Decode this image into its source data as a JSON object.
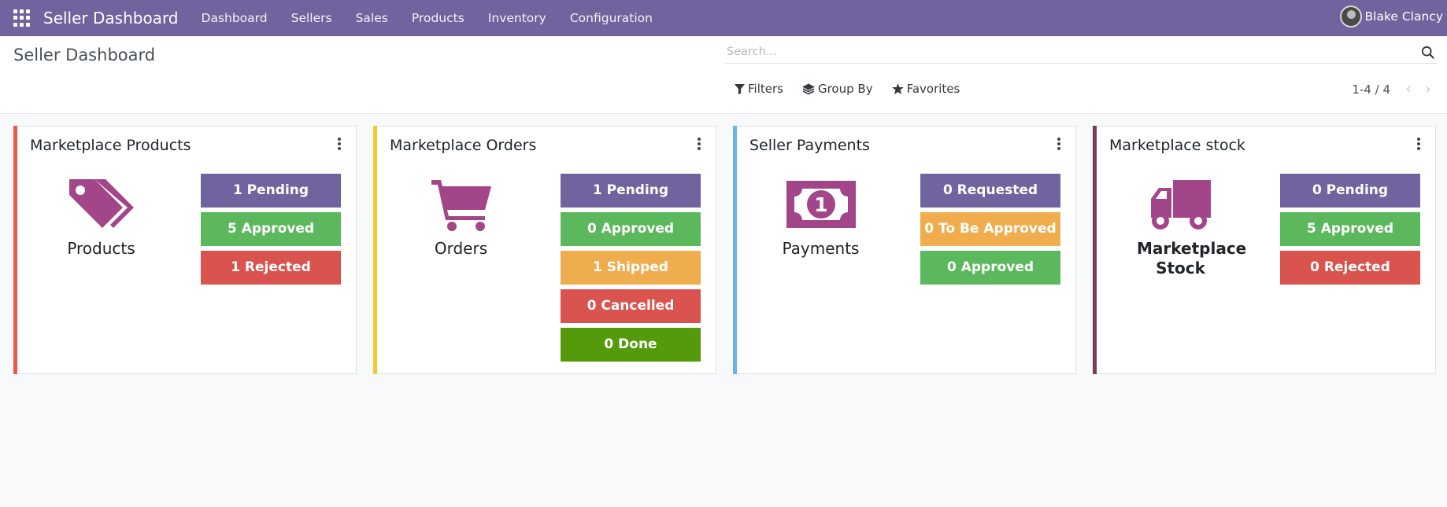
{
  "navbar": {
    "app_title": "Seller Dashboard",
    "menu": [
      "Dashboard",
      "Sellers",
      "Sales",
      "Products",
      "Inventory",
      "Configuration"
    ],
    "user_name": "Blake Clancy"
  },
  "control": {
    "title": "Seller Dashboard",
    "search_placeholder": "Search...",
    "filters_label": "Filters",
    "groupby_label": "Group By",
    "favorites_label": "Favorites",
    "pager": "1-4 / 4"
  },
  "colors": {
    "purple": "#71639e",
    "green": "#5cb85c",
    "red": "#d9534f",
    "orange": "#f0ad4e",
    "dark_green": "#559a0b",
    "icon": "#a24689"
  },
  "cards": [
    {
      "title": "Marketplace Products",
      "stripe": "#e8584c",
      "icon": "tags-icon",
      "label": "Products",
      "stats": [
        {
          "text": "1 Pending",
          "color": "#71639e"
        },
        {
          "text": "5 Approved",
          "color": "#5cb85c"
        },
        {
          "text": "1 Rejected",
          "color": "#d9534f"
        }
      ]
    },
    {
      "title": "Marketplace Orders",
      "stripe": "#f4c92f",
      "icon": "cart-icon",
      "label": "Orders",
      "stats": [
        {
          "text": "1 Pending",
          "color": "#71639e"
        },
        {
          "text": "0 Approved",
          "color": "#5cb85c"
        },
        {
          "text": "1 Shipped",
          "color": "#f0ad4e"
        },
        {
          "text": "0 Cancelled",
          "color": "#d9534f"
        },
        {
          "text": "0 Done",
          "color": "#559a0b"
        }
      ]
    },
    {
      "title": "Seller Payments",
      "stripe": "#6ab5e6",
      "icon": "money-icon",
      "label": "Payments",
      "stats": [
        {
          "text": "0 Requested",
          "color": "#71639e"
        },
        {
          "text": "0 To Be Approved",
          "color": "#f0ad4e"
        },
        {
          "text": "0 Approved",
          "color": "#5cb85c"
        }
      ]
    },
    {
      "title": "Marketplace stock",
      "stripe": "#7a3b5a",
      "icon": "truck-icon",
      "label": "Marketplace Stock",
      "stats": [
        {
          "text": "0 Pending",
          "color": "#71639e"
        },
        {
          "text": "5 Approved",
          "color": "#5cb85c"
        },
        {
          "text": "0 Rejected",
          "color": "#d9534f"
        }
      ]
    }
  ]
}
